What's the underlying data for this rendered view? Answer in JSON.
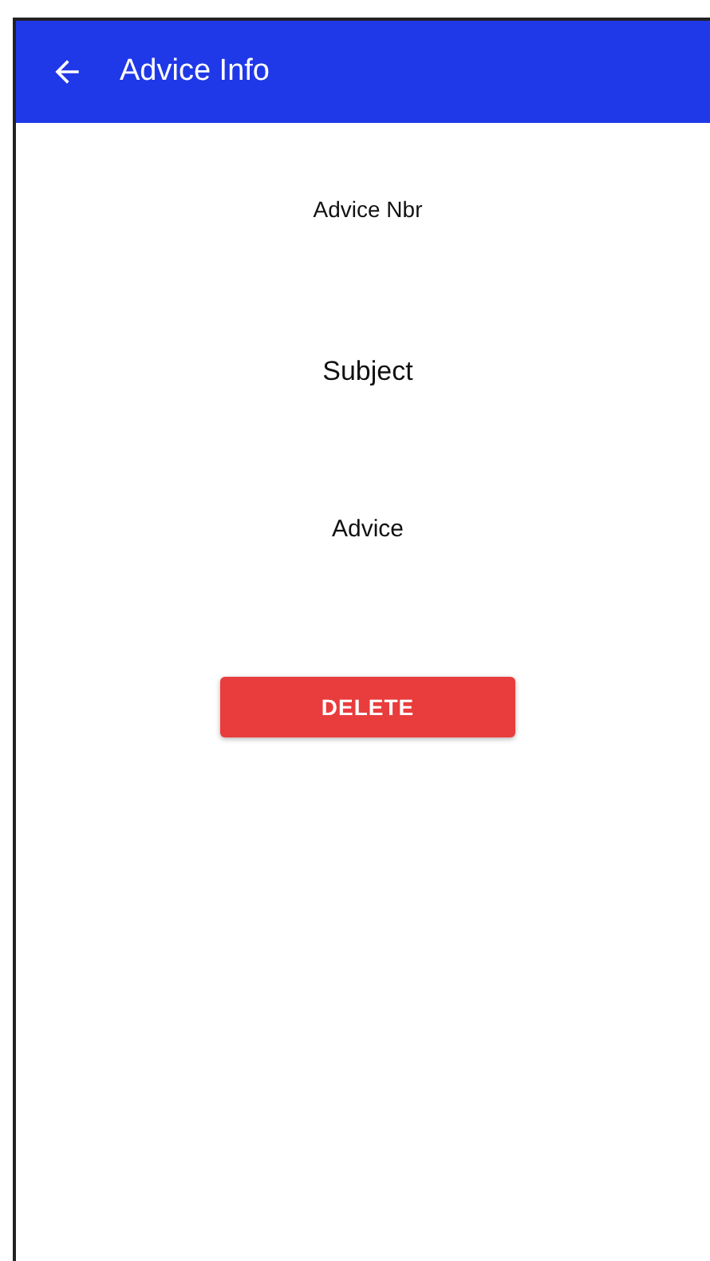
{
  "app_bar": {
    "title": "Advice Info"
  },
  "fields": [
    {
      "kind": "number",
      "text": "Advice Nbr"
    },
    {
      "kind": "subject",
      "text": "Subject"
    },
    {
      "kind": "body",
      "text": "Advice"
    }
  ],
  "delete_button": {
    "label": "DELETE"
  }
}
